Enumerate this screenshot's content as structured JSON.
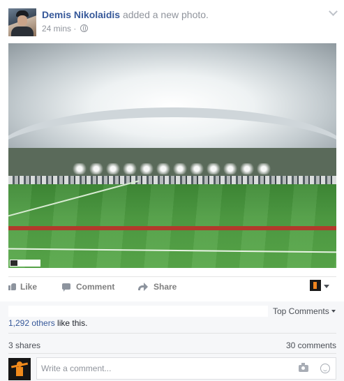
{
  "post": {
    "author_name": "Demis Nikolaidis",
    "action_text": "added a new photo.",
    "timestamp": "24 mins",
    "separator": "·",
    "privacy_icon": "globe-icon",
    "menu_icon": "chevron-down-icon"
  },
  "photo": {
    "description_icon": "stadium-photo"
  },
  "actions": {
    "like_label": "Like",
    "comment_label": "Comment",
    "share_label": "Share",
    "audience_icon": "profile-picture-selector"
  },
  "feedback": {
    "top_comments_label": "Top Comments",
    "likes_link": "1,292 others",
    "likes_rest": " like this.",
    "shares_label": "3 shares",
    "comments_label": "30 comments",
    "comment_placeholder": "Write a comment..."
  },
  "colors": {
    "link": "#365899",
    "muted": "#90949c",
    "action": "#7f7f7f",
    "feedback_bg": "#f6f7f9"
  }
}
